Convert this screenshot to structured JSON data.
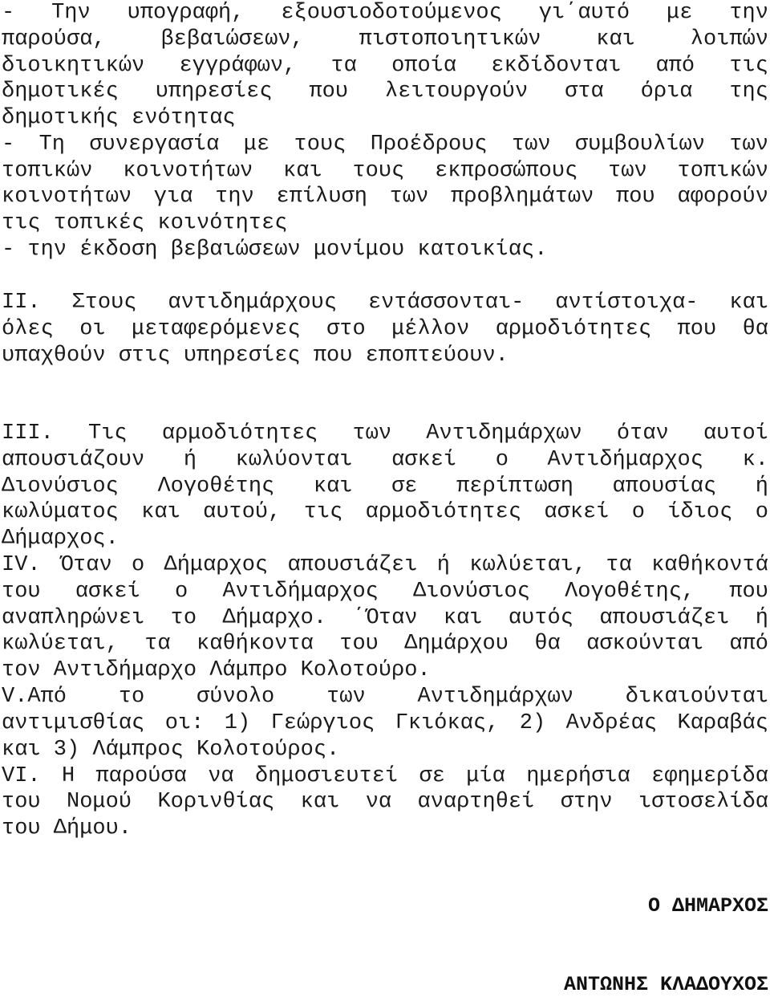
{
  "document": {
    "lines": [
      {
        "text": "- Την υπογραφή, εξουσιοδοτούμενος γι΄αυτό με την",
        "last": false
      },
      {
        "text": "παρούσα, βεβαιώσεων, πιστοποιητικών και λοιπών",
        "last": false
      },
      {
        "text": "διοικητικών εγγράφων, τα οποία εκδίδονται από τις",
        "last": false
      },
      {
        "text": "δημοτικές υπηρεσίες που λειτουργούν στα όρια της",
        "last": false
      },
      {
        "text": "δημοτικής ενότητας",
        "last": true
      },
      {
        "text": "- Τη συνεργασία με τους Προέδρους των συμβουλίων των",
        "last": false
      },
      {
        "text": "τοπικών κοινοτήτων και τους εκπροσώπους των τοπικών",
        "last": false
      },
      {
        "text": "κοινοτήτων για την επίλυση των προβλημάτων που αφορούν",
        "last": false
      },
      {
        "text": "τις τοπικές κοινότητες",
        "last": true
      },
      {
        "text": "- την έκδοση βεβαιώσεων μονίμου κατοικίας.",
        "last": true
      },
      {
        "text": "II. Στους αντιδημάρχους εντάσσονται- αντίστοιχα- και",
        "last": false
      },
      {
        "text": "όλες οι μεταφερόμενες στο μέλλον αρμοδιότητες που θα",
        "last": false
      },
      {
        "text": "υπαχθούν στις υπηρεσίες που εποπτεύουν.",
        "last": true
      },
      {
        "text": "III. Τις αρμοδιότητες των Αντιδημάρχων όταν αυτοί",
        "last": false
      },
      {
        "text": "απουσιάζουν ή κωλύονται ασκεί ο Αντιδήμαρχος κ.",
        "last": false
      },
      {
        "text": "Διονύσιος Λογοθέτης και σε περίπτωση απουσίας ή",
        "last": false
      },
      {
        "text": "κωλύματος και αυτού, τις αρμοδιότητες ασκεί ο ίδιος ο",
        "last": false
      },
      {
        "text": "Δήμαρχος.",
        "last": true
      },
      {
        "text": "IV. Όταν ο Δήμαρχος απουσιάζει ή κωλύεται, τα καθήκοντά",
        "last": false
      },
      {
        "text": "του ασκεί ο Αντιδήμαρχος Διονύσιος Λογοθέτης, που",
        "last": false
      },
      {
        "text": "αναπληρώνει το Δήμαρχο. ΄Όταν και αυτός απουσιάζει ή",
        "last": false
      },
      {
        "text": "κωλύεται, τα καθήκοντα του Δημάρχου θα ασκούνται από",
        "last": false
      },
      {
        "text": "τον Αντιδήμαρχο Λάμπρο Κολοτούρο.",
        "last": true
      },
      {
        "text": "V.Από το σύνολο των Αντιδημάρχων δικαιούνται",
        "last": false
      },
      {
        "text": "αντιμισθίας οι: 1) Γεώργιος Γκιόκας, 2) Ανδρέας Καραβάς",
        "last": false
      },
      {
        "text": "και 3) Λάμπρος Κολοτούρος.",
        "last": true
      },
      {
        "text": "VI. Η παρούσα να δημοσιευτεί σε μία ημερήσια εφημερίδα",
        "last": false
      },
      {
        "text": "του Νομού Κορινθίας και να αναρτηθεί στην ιστοσελίδα",
        "last": false
      },
      {
        "text": "του Δήμου.",
        "last": true
      }
    ],
    "signature": {
      "title": "Ο ΔΗΜΑΡΧΟΣ",
      "name": "ΑΝΤΩΝΗΣ ΚΛΑΔΟΥΧΟΣ"
    }
  }
}
